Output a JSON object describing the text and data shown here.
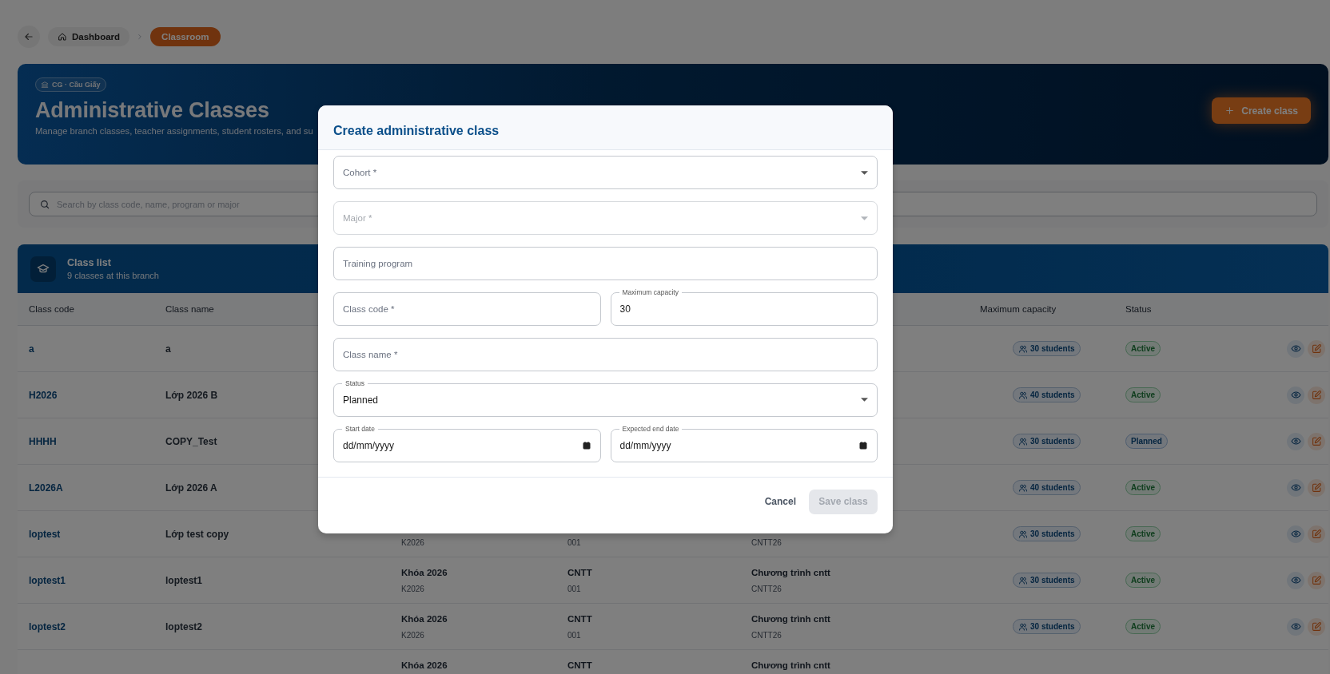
{
  "breadcrumb": [
    {
      "label": "Dashboard",
      "kind": "home",
      "selected": false
    },
    {
      "label": "Classroom",
      "kind": "page",
      "selected": true
    }
  ],
  "hero": {
    "badge": "CG · Cầu Giấy",
    "title": "Administrative Classes",
    "subtitle": "Manage branch classes, teacher assignments, student rosters, and su",
    "action": "Create class"
  },
  "search": {
    "placeholder": "Search by class code, name, program or major"
  },
  "class_list": {
    "title": "Class list",
    "subtitle": "9 classes at this branch",
    "columns": {
      "class_code": "Class code",
      "class_name": "Class name",
      "maximum_capacity": "Maximum capacity",
      "status": "Status"
    },
    "rows": [
      {
        "class_code": "a",
        "class_name": "a",
        "capacity": "30 students",
        "status": {
          "label": "Active",
          "kind": "active"
        }
      },
      {
        "class_code": "H2026",
        "class_name": "Lớp 2026 B",
        "capacity": "40 students",
        "status": {
          "label": "Active",
          "kind": "active"
        }
      },
      {
        "class_code": "HHHH",
        "class_name": "COPY_Test",
        "capacity": "30 students",
        "status": {
          "label": "Planned",
          "kind": "planned"
        }
      },
      {
        "class_code": "L2026A",
        "class_name": "Lớp 2026 A",
        "capacity": "40 students",
        "status": {
          "label": "Active",
          "kind": "active"
        }
      },
      {
        "class_code": "loptest",
        "class_name": "Lớp test copy",
        "cohort": {
          "code": "K2026"
        },
        "major": {
          "code": "001"
        },
        "program": {
          "code": "CNTT26"
        },
        "capacity": "30 students",
        "status": {
          "label": "Active",
          "kind": "active"
        }
      },
      {
        "class_code": "loptest1",
        "class_name": "loptest1",
        "cohort": {
          "name": "Khóa 2026",
          "code": "K2026"
        },
        "major": {
          "name": "CNTT",
          "code": "001"
        },
        "program": {
          "name": "Chương trình cntt",
          "code": "CNTT26"
        },
        "capacity": "30 students",
        "status": {
          "label": "Active",
          "kind": "active"
        }
      },
      {
        "class_code": "loptest2",
        "class_name": "loptest2",
        "cohort": {
          "name": "Khóa 2026",
          "code": "K2026"
        },
        "major": {
          "name": "CNTT",
          "code": "001"
        },
        "program": {
          "name": "Chương trình cntt",
          "code": "CNTT26"
        },
        "capacity": "30 students",
        "status": {
          "label": "Active",
          "kind": "active"
        }
      },
      {
        "cohort": {
          "name": "Khóa 2026"
        },
        "major": {
          "name": "CNTT"
        },
        "program": {
          "name": "Chương trình cntt"
        }
      }
    ]
  },
  "dialog": {
    "title": "Create administrative class",
    "rows": [
      [
        {
          "kind": "select",
          "label": "Cohort *",
          "disabled": false
        }
      ],
      [
        {
          "kind": "select",
          "label": "Major *",
          "disabled": true
        }
      ],
      [
        {
          "kind": "text",
          "label": "Training program",
          "disabled": false
        }
      ],
      [
        {
          "kind": "text",
          "label": "Class code *",
          "disabled": false
        },
        {
          "kind": "text",
          "label": "Maximum capacity",
          "value": "30",
          "disabled": false
        }
      ],
      [
        {
          "kind": "text",
          "label": "Class name *",
          "disabled": false
        }
      ],
      [
        {
          "kind": "select",
          "label": "Status",
          "value": "Planned",
          "disabled": false
        }
      ],
      [
        {
          "kind": "date",
          "label": "Start date",
          "value": "dd/mm/yyyy",
          "disabled": false
        },
        {
          "kind": "date",
          "label": "Expected end date",
          "value": "dd/mm/yyyy",
          "disabled": false
        }
      ]
    ],
    "cancel": "Cancel",
    "submit": {
      "label": "Save class",
      "disabled": true
    }
  }
}
